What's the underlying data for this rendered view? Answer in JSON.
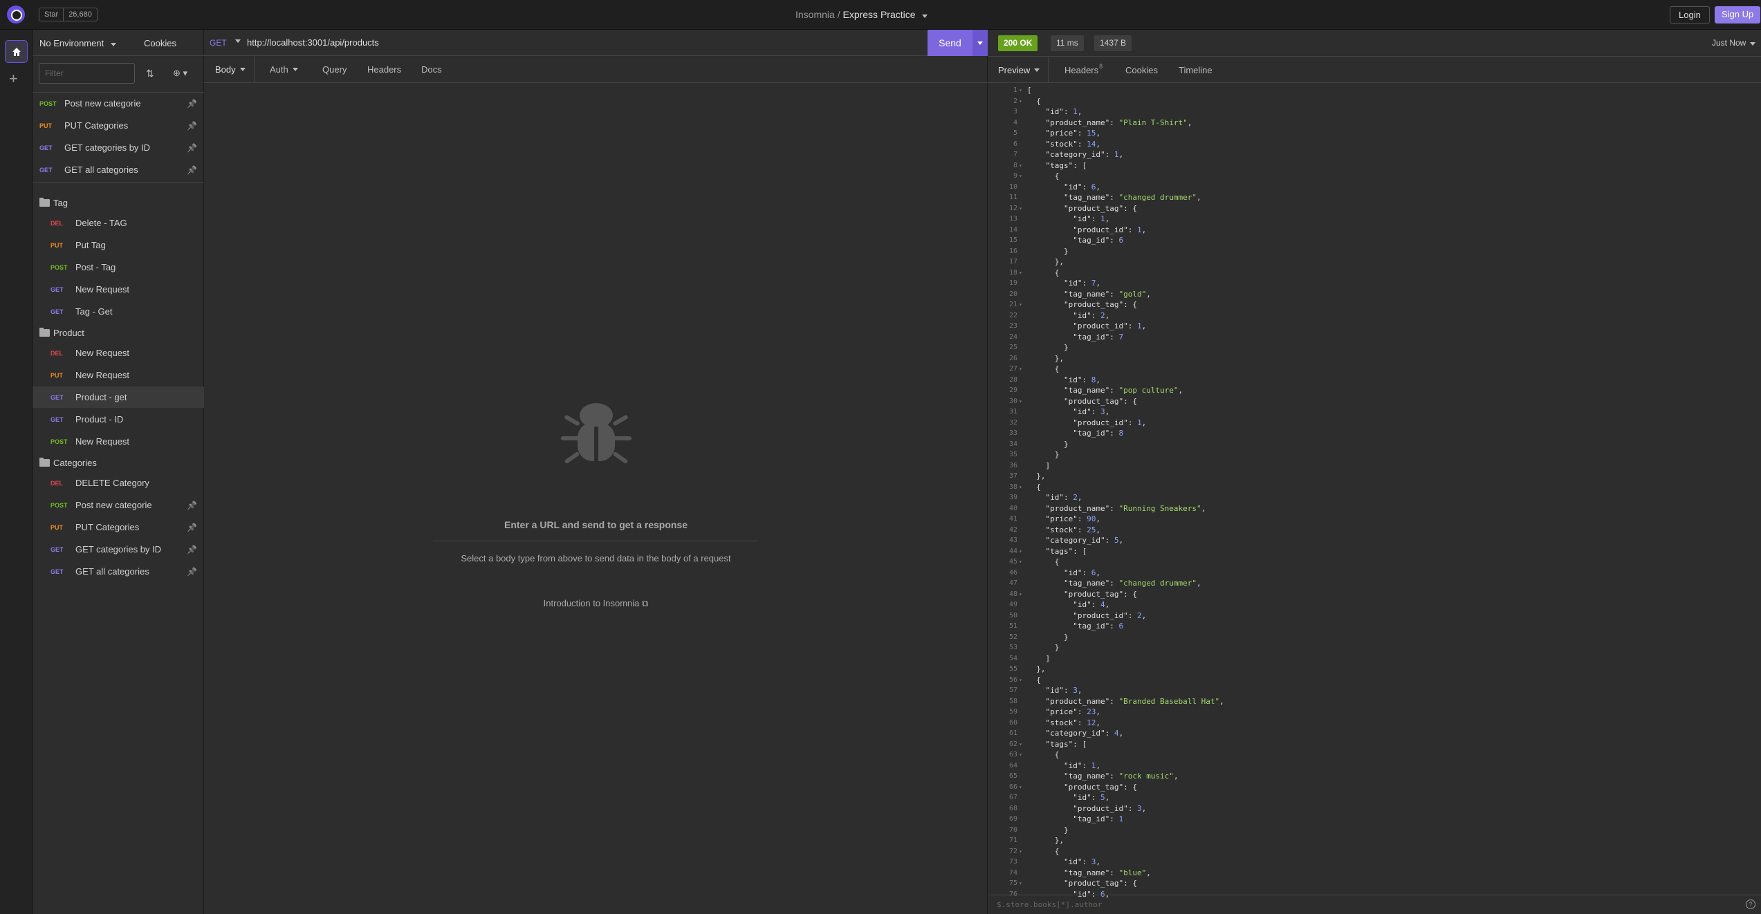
{
  "app": {
    "title_prefix": "Insomnia",
    "title_sep": "/",
    "workspace": "Express Practice",
    "github_star": "Star",
    "github_count": "26,680",
    "login": "Login",
    "signup": "Sign Up"
  },
  "sidebar": {
    "environment": "No Environment",
    "cookies": "Cookies",
    "filter_placeholder": "Filter",
    "pinned": [
      {
        "method": "POST",
        "label": "Post new categorie"
      },
      {
        "method": "PUT",
        "label": "PUT Categories"
      },
      {
        "method": "GET",
        "label": "GET categories by ID"
      },
      {
        "method": "GET",
        "label": "GET all categories"
      }
    ],
    "folders": [
      {
        "name": "Tag",
        "items": [
          {
            "method": "DEL",
            "label": "Delete - TAG"
          },
          {
            "method": "PUT",
            "label": "Put Tag"
          },
          {
            "method": "POST",
            "label": "Post - Tag"
          },
          {
            "method": "GET",
            "label": "New Request"
          },
          {
            "method": "GET",
            "label": "Tag - Get"
          }
        ]
      },
      {
        "name": "Product",
        "items": [
          {
            "method": "DEL",
            "label": "New Request"
          },
          {
            "method": "PUT",
            "label": "New Request"
          },
          {
            "method": "GET",
            "label": "Product - get"
          },
          {
            "method": "GET",
            "label": "Product - ID"
          },
          {
            "method": "POST",
            "label": "New Request"
          }
        ]
      },
      {
        "name": "Categories",
        "items": [
          {
            "method": "DEL",
            "label": "DELETE Category"
          },
          {
            "method": "POST",
            "label": "Post new categorie"
          },
          {
            "method": "PUT",
            "label": "PUT Categories"
          },
          {
            "method": "GET",
            "label": "GET categories by ID"
          },
          {
            "method": "GET",
            "label": "GET all categories"
          }
        ]
      }
    ]
  },
  "request": {
    "method": "GET",
    "url": "http://localhost:3001/api/products",
    "send": "Send",
    "tabs": [
      "Body",
      "Auth",
      "Query",
      "Headers",
      "Docs"
    ],
    "empty_title": "Enter a URL and send to get a response",
    "empty_sub": "Select a body type from above to send data in the body of a request",
    "intro": "Introduction to Insomnia"
  },
  "response": {
    "status": "200 OK",
    "time": "11 ms",
    "size": "1437 B",
    "when": "Just Now",
    "tabs": [
      "Preview",
      "Headers",
      "Cookies",
      "Timeline"
    ],
    "headers_count": "8",
    "filter_placeholder": "$.store.books[*].author",
    "help": "?",
    "lines": [
      "[",
      "  {",
      "    \"id\": 1,",
      "    \"product_name\": \"Plain T-Shirt\",",
      "    \"price\": 15,",
      "    \"stock\": 14,",
      "    \"category_id\": 1,",
      "    \"tags\": [",
      "      {",
      "        \"id\": 6,",
      "        \"tag_name\": \"changed drummer\",",
      "        \"product_tag\": {",
      "          \"id\": 1,",
      "          \"product_id\": 1,",
      "          \"tag_id\": 6",
      "        }",
      "      },",
      "      {",
      "        \"id\": 7,",
      "        \"tag_name\": \"gold\",",
      "        \"product_tag\": {",
      "          \"id\": 2,",
      "          \"product_id\": 1,",
      "          \"tag_id\": 7",
      "        }",
      "      },",
      "      {",
      "        \"id\": 8,",
      "        \"tag_name\": \"pop culture\",",
      "        \"product_tag\": {",
      "          \"id\": 3,",
      "          \"product_id\": 1,",
      "          \"tag_id\": 8",
      "        }",
      "      }",
      "    ]",
      "  },",
      "  {",
      "    \"id\": 2,",
      "    \"product_name\": \"Running Sneakers\",",
      "    \"price\": 90,",
      "    \"stock\": 25,",
      "    \"category_id\": 5,",
      "    \"tags\": [",
      "      {",
      "        \"id\": 6,",
      "        \"tag_name\": \"changed drummer\",",
      "        \"product_tag\": {",
      "          \"id\": 4,",
      "          \"product_id\": 2,",
      "          \"tag_id\": 6",
      "        }",
      "      }",
      "    ]",
      "  },",
      "  {",
      "    \"id\": 3,",
      "    \"product_name\": \"Branded Baseball Hat\",",
      "    \"price\": 23,",
      "    \"stock\": 12,",
      "    \"category_id\": 4,",
      "    \"tags\": [",
      "      {",
      "        \"id\": 1,",
      "        \"tag_name\": \"rock music\",",
      "        \"product_tag\": {",
      "          \"id\": 5,",
      "          \"product_id\": 3,",
      "          \"tag_id\": 1",
      "        }",
      "      },",
      "      {",
      "        \"id\": 3,",
      "        \"tag_name\": \"blue\",",
      "        \"product_tag\": {",
      "          \"id\": 6,"
    ]
  },
  "colors": {
    "accent": "#7d67df",
    "get": "#8d7ae8",
    "post": "#75ba24",
    "put": "#ee8a1e",
    "del": "#e5484d",
    "ok": "#67a21e"
  }
}
